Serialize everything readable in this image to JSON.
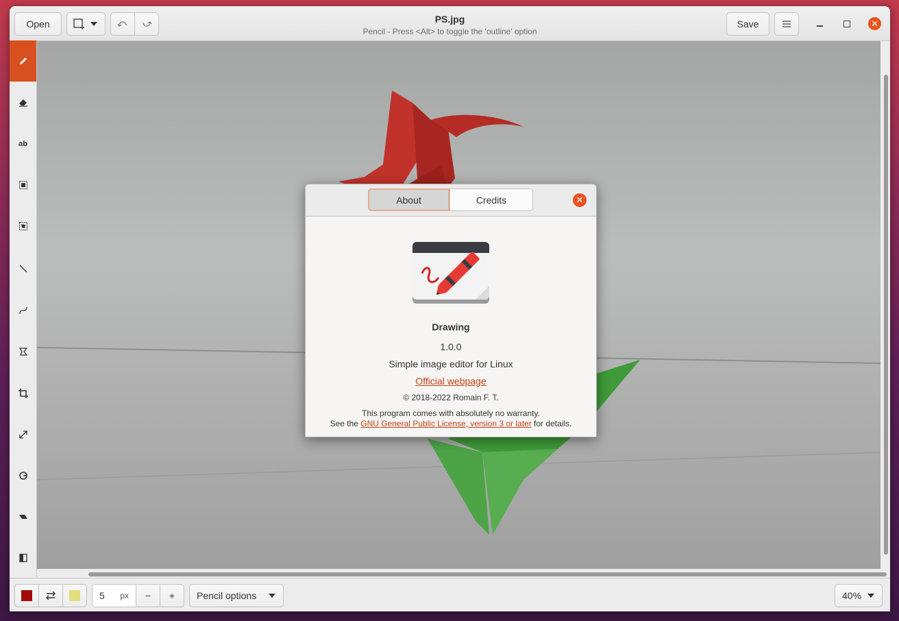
{
  "header": {
    "open_label": "Open",
    "title": "PS.jpg",
    "subtitle": "Pencil - Press <Alt> to toggle the 'outline' option",
    "save_label": "Save"
  },
  "bottom": {
    "size_value": "5",
    "size_unit": "px",
    "minus": "−",
    "plus": "+",
    "options_label": "Pencil options",
    "zoom": "40%",
    "main_color": "#a30b0b",
    "secondary_color": "#e1de7b"
  },
  "dialog": {
    "tab_about": "About",
    "tab_credits": "Credits",
    "app_name": "Drawing",
    "version": "1.0.0",
    "description": "Simple image editor for Linux",
    "website_label": "Official webpage",
    "copyright": "© 2018-2022 Romain F. T.",
    "warranty_line1": "This program comes with absolutely no warranty.",
    "warranty_prefix": "See the ",
    "license_link": "GNU General Public License, version 3 or later",
    "warranty_suffix": " for details."
  },
  "tools": [
    "pencil-icon",
    "eraser-icon",
    "text-icon",
    "rect-select-icon",
    "free-select-icon",
    "line-icon",
    "curve-icon",
    "shape-icon",
    "crop-icon",
    "scale-icon",
    "rotate-icon",
    "skew-icon",
    "filters-icon"
  ],
  "accent": "#e95420"
}
